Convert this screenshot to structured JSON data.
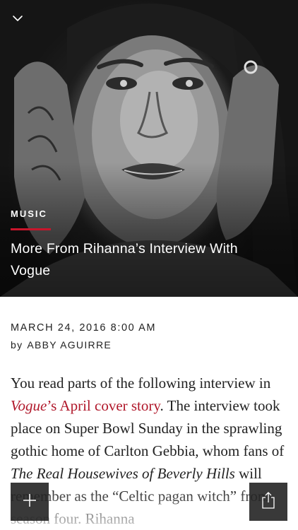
{
  "hero": {
    "image_alt": "Rihanna portrait, black and white",
    "category": "MUSIC",
    "headline": "More From Rihanna’s Interview With Vogue",
    "accent_color": "#c8152b"
  },
  "meta": {
    "date": "MARCH 24, 2016 8:00 AM",
    "by_label": "by",
    "author": "ABBY AGUIRRE"
  },
  "article": {
    "p1_before": "You read parts of the following interview in ",
    "link_title": "Vogue",
    "link_rest": "’s April cover story",
    "p1_mid": ". The interview took place on Super Bowl Sunday in the sprawling gothic home of Carlton Gebbia, whom fans of ",
    "show_title": "The Real Housewives of Beverly Hills",
    "p1_end": " will remember as the “Celtic pagan witch” from season four. Rihanna",
    "link_color": "#b0172a"
  },
  "controls": {
    "collapse_icon": "chevron-down-icon",
    "add_icon": "plus-icon",
    "share_icon": "share-icon"
  }
}
